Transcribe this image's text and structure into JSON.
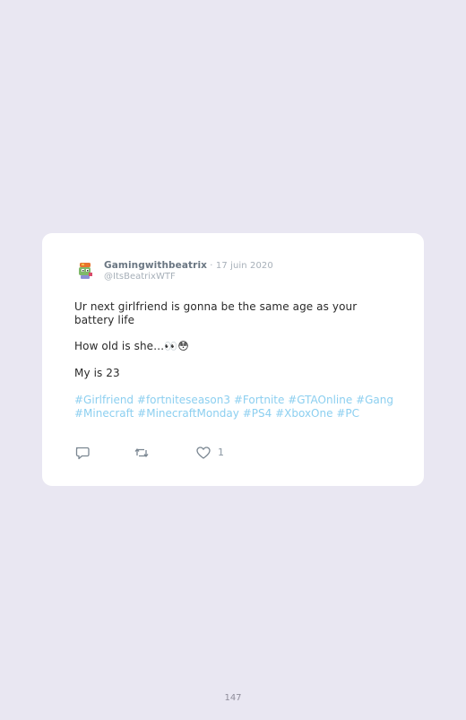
{
  "tweet": {
    "author_name": "Gamingwithbeatrix",
    "separator": " · ",
    "date": "17 juin 2020",
    "handle": "@ItsBeatrixWTF",
    "lines": [
      "Ur next girlfriend is gonna be the same age as your battery life",
      "How old is she…👀😳",
      "My is 23"
    ],
    "hashtags": [
      "#Girlfriend",
      "#fortniteseason3",
      "#Fortnite",
      "#GTAOnline",
      "#Gang",
      "#Minecraft",
      "#MinecraftMonday",
      "#PS4",
      "#XboxOne",
      "#PC"
    ],
    "like_count": "1"
  },
  "icons": {
    "avatar": "avatar-icon",
    "reply": "reply-icon",
    "retweet": "retweet-icon",
    "like": "heart-icon"
  },
  "colors": {
    "background": "#e9e7f2",
    "card": "#ffffff",
    "hashtag": "#8ccff0",
    "name": "#6a7682",
    "muted": "#a7b0b9"
  },
  "page": {
    "number": "147"
  }
}
